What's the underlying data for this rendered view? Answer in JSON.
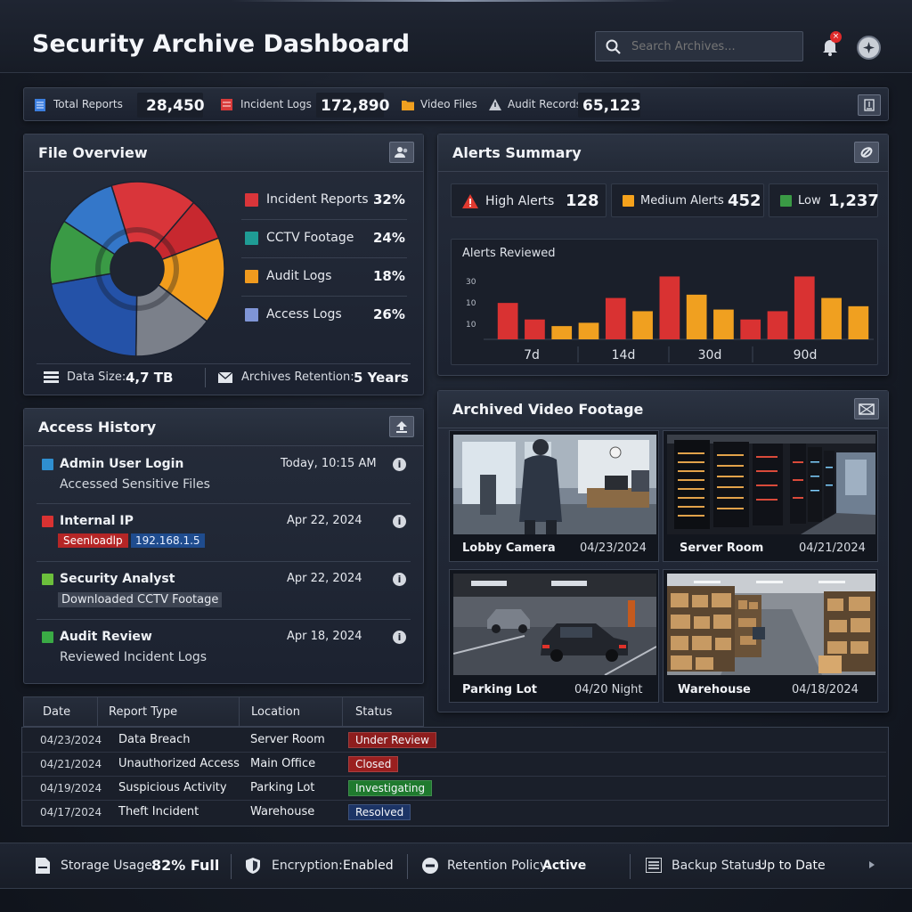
{
  "header": {
    "title": "Security Archive Dashboard",
    "search_placeholder": "Search Archives..."
  },
  "stats_bar": {
    "items": [
      {
        "label": "Total Reports",
        "value": "28,450",
        "color": "#3b7ddd"
      },
      {
        "label": "Incident Logs",
        "value": "172,890",
        "color": "#d83a3a"
      },
      {
        "label": "Video Files",
        "value": "",
        "color": "#f0a020"
      },
      {
        "label": "Audit Records",
        "value": "65,123",
        "color": "#c8ccd4"
      }
    ]
  },
  "file_overview": {
    "title": "File Overview",
    "legend": [
      {
        "label": "Incident Reports",
        "value": "32%",
        "color": "#d9353a"
      },
      {
        "label": "CCTV Footage",
        "value": "24%",
        "color": "#1f9c95"
      },
      {
        "label": "Audit Logs",
        "value": "18%",
        "color": "#f09a1e"
      },
      {
        "label": "Access Logs",
        "value": "26%",
        "color": "#7f95d6"
      }
    ],
    "donut_slices": [
      {
        "fraction": 0.16,
        "color": "#d9353a"
      },
      {
        "fraction": 0.08,
        "color": "#c7282f"
      },
      {
        "fraction": 0.16,
        "color": "#f29d1c"
      },
      {
        "fraction": 0.15,
        "color": "#7b808a"
      },
      {
        "fraction": 0.22,
        "color": "#2452a8"
      },
      {
        "fraction": 0.12,
        "color": "#3a9a45"
      },
      {
        "fraction": 0.11,
        "color": "#3477c9"
      }
    ],
    "data_size_label": "Data Size:",
    "data_size_value": "4,7 TB",
    "retention_label": "Archives Retention:",
    "retention_value": "5 Years"
  },
  "alerts_summary": {
    "title": "Alerts Summary",
    "cards": [
      {
        "label": "High Alerts",
        "value": "128",
        "color": "#e03a30"
      },
      {
        "label": "Medium Alerts",
        "value": "452",
        "color": "#f5a21c"
      },
      {
        "label": "Low",
        "value": "1,237",
        "color": "#3a9a45"
      }
    ]
  },
  "chart_data": {
    "type": "bar",
    "title": "Alerts Reviewed",
    "categories": [
      "7d",
      "14d",
      "30d",
      "90d"
    ],
    "y_ticks": [
      "30",
      "10",
      "10"
    ],
    "bars": [
      {
        "value": 22,
        "color": "#d93232"
      },
      {
        "value": 12,
        "color": "#d93232"
      },
      {
        "value": 8,
        "color": "#f0a020"
      },
      {
        "value": 10,
        "color": "#f0a020"
      },
      {
        "value": 25,
        "color": "#d93232"
      },
      {
        "value": 17,
        "color": "#f0a020"
      },
      {
        "value": 38,
        "color": "#d93232"
      },
      {
        "value": 27,
        "color": "#f0a020"
      },
      {
        "value": 18,
        "color": "#f0a020"
      },
      {
        "value": 12,
        "color": "#d93232"
      },
      {
        "value": 17,
        "color": "#d93232"
      },
      {
        "value": 38,
        "color": "#d93232"
      },
      {
        "value": 25,
        "color": "#f0a020"
      },
      {
        "value": 20,
        "color": "#f0a020"
      }
    ],
    "ylim": [
      0,
      42
    ]
  },
  "access_history": {
    "title": "Access History",
    "items": [
      {
        "title": "Admin User Login",
        "subtitle": "Accessed Sensitive Files",
        "time": "Today, 10:15 AM",
        "color": "#2f8fd0"
      },
      {
        "title": "Internal IP",
        "badge_red": "Seenloadlp",
        "badge_blue": "192.168.1.5",
        "time": "Apr 22, 2024",
        "color": "#d93232"
      },
      {
        "title": "Security Analyst",
        "subtitle": "Downloaded CCTV Footage",
        "time": "Apr 22, 2024",
        "color": "#6cbf3c"
      },
      {
        "title": "Audit Review",
        "subtitle": "Reviewed Incident Logs",
        "time": "Apr 18, 2024",
        "color": "#3aaa45"
      }
    ]
  },
  "video_footage": {
    "title": "Archived Video Footage",
    "tiles": [
      {
        "label": "Lobby Camera",
        "date": "04/23/2024"
      },
      {
        "label": "Server Room",
        "date": "04/21/2024"
      },
      {
        "label": "Parking Lot",
        "date": "04/20 Night"
      },
      {
        "label": "Warehouse",
        "date": "04/18/2024"
      }
    ]
  },
  "reports_table": {
    "headers": [
      "Date",
      "Report Type",
      "Location",
      "Status"
    ],
    "rows": [
      {
        "date": "04/23/2024",
        "type": "Data Breach",
        "location": "Server Room",
        "status": "Under Review",
        "status_color": "#8e1d1d"
      },
      {
        "date": "04/21/2024",
        "type": "Unauthorized Access",
        "location": "Main Office",
        "status": "Closed",
        "status_color": "#9a1f1f"
      },
      {
        "date": "04/19/2024",
        "type": "Suspicious Activity",
        "location": "Parking Lot",
        "status": "Investigating",
        "status_color": "#1f7a2e"
      },
      {
        "date": "04/17/2024",
        "type": "Theft Incident",
        "location": "Warehouse",
        "status": "Resolved",
        "status_color": "#1c3466"
      }
    ]
  },
  "footer": {
    "storage_label": "Storage Usage:",
    "storage_value": "82% Full",
    "encryption_label": "Encryption:",
    "encryption_value": "Enabled",
    "retention_label": "Retention Policy:",
    "retention_value": "Active",
    "backup_label": "Backup Status:",
    "backup_value": "Up to Date"
  }
}
